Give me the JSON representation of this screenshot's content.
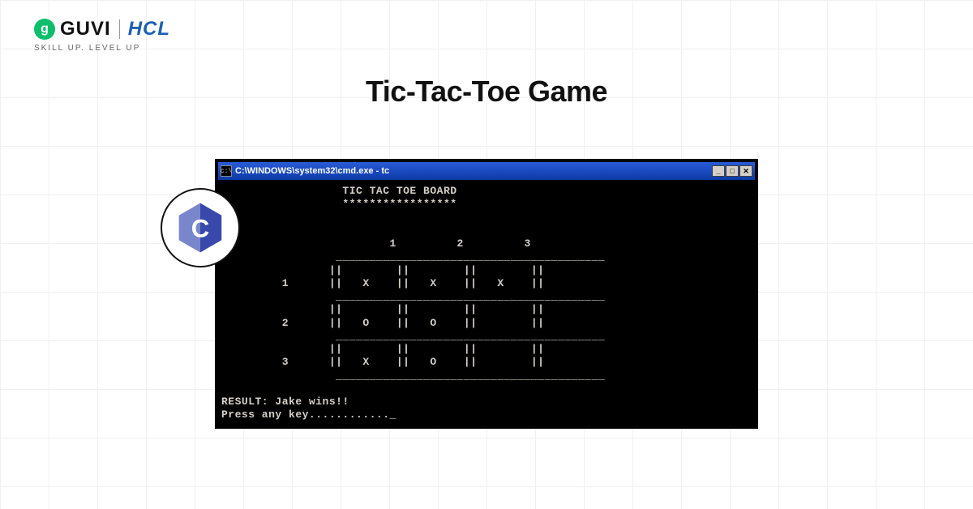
{
  "brand": {
    "guvi_glyph": "g",
    "guvi_text": "GUVI",
    "hcl_text": "HCL",
    "tagline": "Skill Up. Level Up"
  },
  "page": {
    "title": "Tic-Tac-Toe Game"
  },
  "console": {
    "title_icon": "c:\\",
    "title_path": "C:\\WINDOWS\\system32\\cmd.exe - tc",
    "heading": "TIC TAC TOE BOARD",
    "underline": "*****************",
    "col_headers": [
      "1",
      "2",
      "3"
    ],
    "row_headers": [
      "1",
      "2",
      "3"
    ],
    "cells": [
      [
        "X",
        "X",
        "X"
      ],
      [
        "O",
        "O",
        " "
      ],
      [
        "X",
        "O",
        " "
      ]
    ],
    "result_line": "RESULT: Jake wins!!",
    "press_line": "Press any key............_"
  },
  "badge": {
    "letter": "C"
  }
}
